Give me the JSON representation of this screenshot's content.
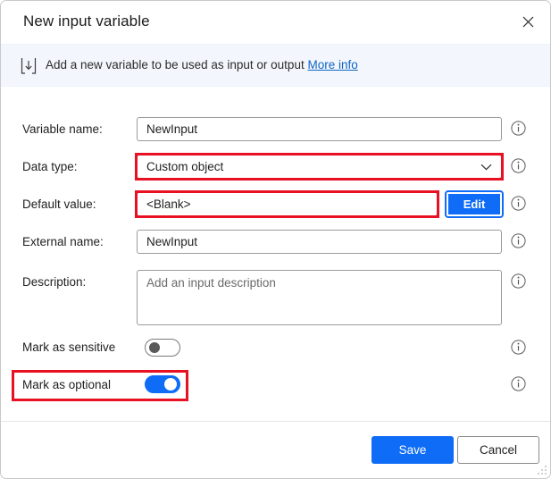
{
  "window": {
    "title": "New input variable",
    "close_icon": "close-icon"
  },
  "banner": {
    "icon": "input-variable-icon",
    "text": "Add a new variable to be used as input or output",
    "link_label": "More info"
  },
  "form": {
    "rows": [
      {
        "label": "Variable name:",
        "type": "text",
        "value": "NewInput",
        "highlighted": false
      },
      {
        "label": "Data type:",
        "type": "select",
        "value": "Custom object",
        "highlighted": true
      },
      {
        "label": "Default value:",
        "type": "text",
        "value": "<Blank>",
        "highlighted": true,
        "button_label": "Edit"
      },
      {
        "label": "External name:",
        "type": "text",
        "value": "NewInput",
        "highlighted": false
      },
      {
        "label": "Description:",
        "type": "textarea",
        "placeholder": "Add an input description",
        "highlighted": false
      }
    ],
    "toggles": [
      {
        "label": "Mark as sensitive",
        "on": false,
        "highlighted": false
      },
      {
        "label": "Mark as optional",
        "on": true,
        "highlighted": true
      }
    ],
    "info_icon": "info-icon"
  },
  "footer": {
    "save_label": "Save",
    "cancel_label": "Cancel"
  },
  "colors": {
    "accent": "#0f6cf6",
    "highlight": "#e81123",
    "banner_bg": "#f3f7fd",
    "link": "#1063c4"
  }
}
